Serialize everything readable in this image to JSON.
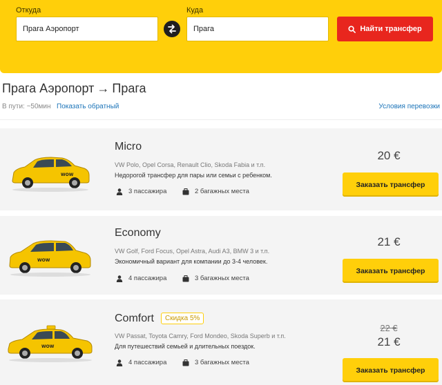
{
  "search": {
    "from_label": "Откуда",
    "from_value": "Прага Аэропорт",
    "to_label": "Куда",
    "to_value": "Прага",
    "search_button": "Найти трансфер"
  },
  "route": {
    "from": "Прага Аэропорт",
    "arrow": "→",
    "to": "Прага",
    "duration": "В пути: ~50мин",
    "reverse_link": "Показать обратный",
    "conditions_link": "Условия перевозки"
  },
  "cars": [
    {
      "name": "Micro",
      "models": "VW Polo, Opel Corsa, Renault Clio, Skoda Fabia и т.п.",
      "description": "Недорогой трансфер для пары или семьи с ребенком.",
      "passengers": "3 пассажира",
      "luggage": "2 багажных места",
      "price": "20 €",
      "order_button": "Заказать трансфер"
    },
    {
      "name": "Economy",
      "models": "VW Golf, Ford Focus, Opel Astra, Audi A3, BMW 3 и т.п.",
      "description": "Экономичный вариант для компании до 3-4 человек.",
      "passengers": "4 пассажира",
      "luggage": "3 багажных места",
      "price": "21 €",
      "order_button": "Заказать трансфер"
    },
    {
      "name": "Comfort",
      "discount_badge": "Скидка 5%",
      "models": "VW Passat, Toyota Camry, Ford Mondeo, Skoda Superb и т.п.",
      "description": "Для путешествий семьей и длительных поездок.",
      "passengers": "4 пассажира",
      "luggage": "3 багажных места",
      "old_price": "22 €",
      "price": "21 €",
      "order_button": "Заказать трансфер"
    }
  ],
  "colors": {
    "brand_yellow": "#ffcf0a",
    "search_red": "#e8261e",
    "link_blue": "#1a73b8",
    "card_bg": "#f4f4f4"
  },
  "icons": [
    "swap-arrows-icon",
    "search-icon",
    "person-icon",
    "suitcase-icon",
    "taxi-car-icon"
  ]
}
